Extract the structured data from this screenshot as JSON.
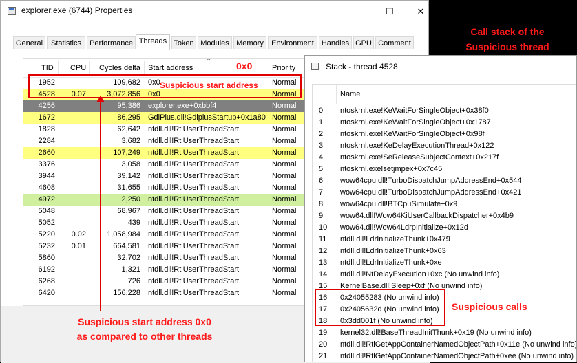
{
  "main_window": {
    "title": "explorer.exe (6744) Properties",
    "minimize": "—",
    "maximize": "☐",
    "close": "✕",
    "tabs": [
      "General",
      "Statistics",
      "Performance",
      "Threads",
      "Token",
      "Modules",
      "Memory",
      "Environment",
      "Handles",
      "GPU",
      "Comment"
    ],
    "active_tab": "Threads"
  },
  "threads_table": {
    "columns": [
      "TID",
      "CPU",
      "Cycles delta",
      "Start address",
      "Priority"
    ],
    "rows": [
      {
        "tid": "1952",
        "cpu": "",
        "cycles": "109,682",
        "start": "0x0",
        "priority": "Normal",
        "style": "white"
      },
      {
        "tid": "4528",
        "cpu": "0.07",
        "cycles": "3,072,856",
        "start": "0x0",
        "priority": "Normal",
        "style": "yellow"
      },
      {
        "tid": "4256",
        "cpu": "",
        "cycles": "95,386",
        "start": "explorer.exe+0xbbf4",
        "priority": "Normal",
        "style": "gray"
      },
      {
        "tid": "1672",
        "cpu": "",
        "cycles": "86,295",
        "start": "GdiPlus.dll!GdiplusStartup+0x1a80",
        "priority": "Normal",
        "style": "yellow"
      },
      {
        "tid": "1828",
        "cpu": "",
        "cycles": "62,642",
        "start": "ntdll.dll!RtlUserThreadStart",
        "priority": "Normal",
        "style": "white"
      },
      {
        "tid": "2284",
        "cpu": "",
        "cycles": "3,682",
        "start": "ntdll.dll!RtlUserThreadStart",
        "priority": "Normal",
        "style": "white"
      },
      {
        "tid": "2660",
        "cpu": "",
        "cycles": "107,249",
        "start": "ntdll.dll!RtlUserThreadStart",
        "priority": "Normal",
        "style": "yellow"
      },
      {
        "tid": "3376",
        "cpu": "",
        "cycles": "3,058",
        "start": "ntdll.dll!RtlUserThreadStart",
        "priority": "Normal",
        "style": "white"
      },
      {
        "tid": "3944",
        "cpu": "",
        "cycles": "39,142",
        "start": "ntdll.dll!RtlUserThreadStart",
        "priority": "Normal",
        "style": "white"
      },
      {
        "tid": "4608",
        "cpu": "",
        "cycles": "31,655",
        "start": "ntdll.dll!RtlUserThreadStart",
        "priority": "Normal",
        "style": "white"
      },
      {
        "tid": "4972",
        "cpu": "",
        "cycles": "2,250",
        "start": "ntdll.dll!RtlUserThreadStart",
        "priority": "Normal",
        "style": "green"
      },
      {
        "tid": "5048",
        "cpu": "",
        "cycles": "68,967",
        "start": "ntdll.dll!RtlUserThreadStart",
        "priority": "Normal",
        "style": "white"
      },
      {
        "tid": "5052",
        "cpu": "",
        "cycles": "439",
        "start": "ntdll.dll!RtlUserThreadStart",
        "priority": "Normal",
        "style": "white"
      },
      {
        "tid": "5220",
        "cpu": "0.02",
        "cycles": "1,058,984",
        "start": "ntdll.dll!RtlUserThreadStart",
        "priority": "Normal",
        "style": "white"
      },
      {
        "tid": "5232",
        "cpu": "0.01",
        "cycles": "664,581",
        "start": "ntdll.dll!RtlUserThreadStart",
        "priority": "Normal",
        "style": "white"
      },
      {
        "tid": "5860",
        "cpu": "",
        "cycles": "32,702",
        "start": "ntdll.dll!RtlUserThreadStart",
        "priority": "Normal",
        "style": "white"
      },
      {
        "tid": "6192",
        "cpu": "",
        "cycles": "1,321",
        "start": "ntdll.dll!RtlUserThreadStart",
        "priority": "Normal",
        "style": "white"
      },
      {
        "tid": "6268",
        "cpu": "",
        "cycles": "726",
        "start": "ntdll.dll!RtlUserThreadStart",
        "priority": "Normal",
        "style": "white"
      },
      {
        "tid": "6420",
        "cpu": "",
        "cycles": "156,228",
        "start": "ntdll.dll!RtlUserThreadStart",
        "priority": "Normal",
        "style": "white"
      }
    ]
  },
  "stack_window": {
    "title": "Stack - thread 4528",
    "column": "Name",
    "frames": [
      {
        "idx": "0",
        "name": "ntoskrnl.exe!KeWaitForSingleObject+0x38f0"
      },
      {
        "idx": "1",
        "name": "ntoskrnl.exe!KeWaitForSingleObject+0x1787"
      },
      {
        "idx": "2",
        "name": "ntoskrnl.exe!KeWaitForSingleObject+0x98f"
      },
      {
        "idx": "3",
        "name": "ntoskrnl.exe!KeDelayExecutionThread+0x122"
      },
      {
        "idx": "4",
        "name": "ntoskrnl.exe!SeReleaseSubjectContext+0x217f"
      },
      {
        "idx": "5",
        "name": "ntoskrnl.exe!setjmpex+0x7c45"
      },
      {
        "idx": "6",
        "name": "wow64cpu.dll!TurboDispatchJumpAddressEnd+0x544"
      },
      {
        "idx": "7",
        "name": "wow64cpu.dll!TurboDispatchJumpAddressEnd+0x421"
      },
      {
        "idx": "8",
        "name": "wow64cpu.dll!BTCpuSimulate+0x9"
      },
      {
        "idx": "9",
        "name": "wow64.dll!Wow64KiUserCallbackDispatcher+0x4b9"
      },
      {
        "idx": "10",
        "name": "wow64.dll!Wow64LdrpInitialize+0x12d"
      },
      {
        "idx": "11",
        "name": "ntdll.dll!LdrInitializeThunk+0x479"
      },
      {
        "idx": "12",
        "name": "ntdll.dll!LdrInitializeThunk+0x63"
      },
      {
        "idx": "13",
        "name": "ntdll.dll!LdrInitializeThunk+0xe"
      },
      {
        "idx": "14",
        "name": "ntdll.dll!NtDelayExecution+0xc (No unwind info)"
      },
      {
        "idx": "15",
        "name": "KernelBase.dll!Sleep+0xf (No unwind info)"
      },
      {
        "idx": "16",
        "name": "0x24055283 (No unwind info)"
      },
      {
        "idx": "17",
        "name": "0x2405632d (No unwind info)"
      },
      {
        "idx": "18",
        "name": "0x3dd001f (No unwind info)"
      },
      {
        "idx": "19",
        "name": "kernel32.dll!BaseThreadInitThunk+0x19 (No unwind info)"
      },
      {
        "idx": "20",
        "name": "ntdll.dll!RtlGetAppContainerNamedObjectPath+0x11e (No unwind info)"
      },
      {
        "idx": "21",
        "name": "ntdll.dll!RtlGetAppContainerNamedObjectPath+0xee (No unwind info)"
      }
    ]
  },
  "annotations": {
    "top_right_line1": "Call stack of the",
    "top_right_line2": "Suspicious thread",
    "zero_label": "0x0",
    "suspicious_start": "Suspicious start address",
    "bottom_line1": "Suspicious start address 0x0",
    "bottom_line2": "as compared to other threads",
    "suspicious_calls": "Suspicious calls",
    "highlight_color": "#ff1a1a"
  }
}
